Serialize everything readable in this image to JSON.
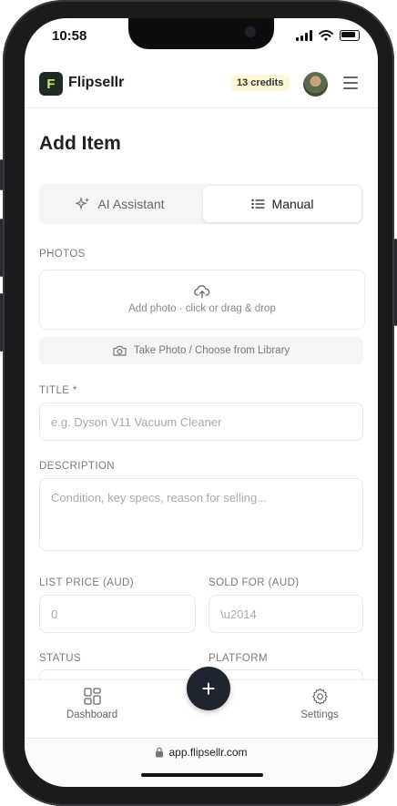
{
  "status_bar": {
    "time": "10:58"
  },
  "header": {
    "brand": "Flipsellr",
    "credits": "13 credits"
  },
  "page": {
    "title": "Add Item"
  },
  "mode_toggle": {
    "ai_label": "AI Assistant",
    "manual_label": "Manual",
    "selected": "Manual"
  },
  "photos": {
    "label": "PHOTOS",
    "dropzone_text": "Add photo · click or drag & drop",
    "camera_button": "Take Photo / Choose from Library"
  },
  "form": {
    "title_label": "TITLE *",
    "title_placeholder": "e.g. Dyson V11 Vacuum Cleaner",
    "description_label": "DESCRIPTION",
    "description_placeholder": "Condition, key specs, reason for selling...",
    "list_price_label": "LIST PRICE (AUD)",
    "list_price_placeholder": "0",
    "sold_for_label": "SOLD FOR (AUD)",
    "sold_for_placeholder": "\\u2014",
    "status_label": "STATUS",
    "platform_label": "PLATFORM"
  },
  "bottom_nav": {
    "dashboard": "Dashboard",
    "add": "+",
    "settings": "Settings"
  },
  "browser": {
    "url": "app.flipsellr.com"
  },
  "colors": {
    "accent": "#1e2530",
    "credits_bg": "#fdf8d6",
    "logo_bg": "#1f2a23"
  }
}
